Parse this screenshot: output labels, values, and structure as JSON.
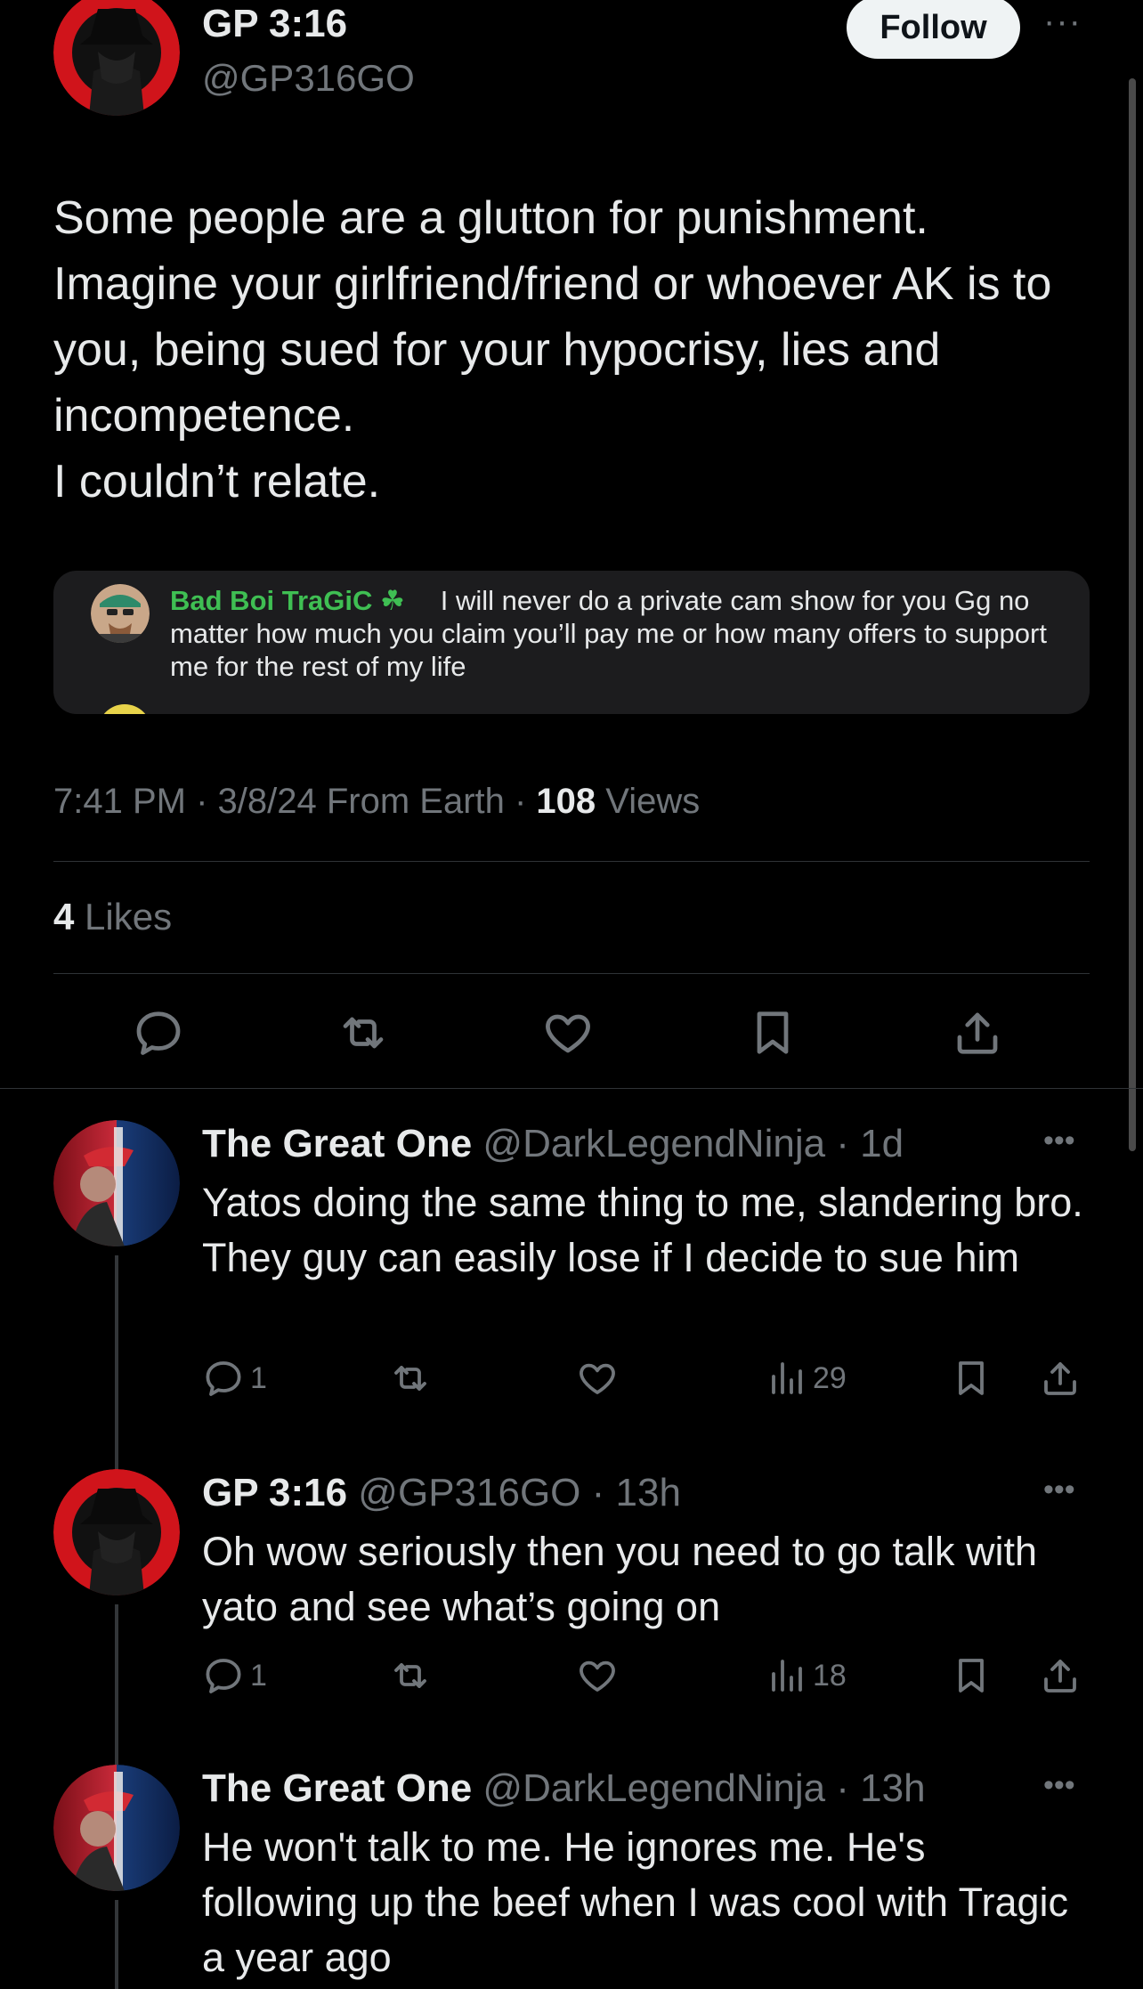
{
  "main_tweet": {
    "name": "GP 3:16",
    "handle": "@GP316GO",
    "follow_label": "Follow",
    "more_label": "···",
    "text": "Some people are a glutton for punishment.\nImagine your girlfriend/friend or whoever AK is to you, being sued for your hypocrisy, lies and incompetence.\nI couldn’t relate.",
    "quote": {
      "name": "Bad Boi TraGiC ☘",
      "text": "I will never do a private cam show for you Gg no matter how much you claim you’ll pay me or how many offers to support me for the rest of my life"
    },
    "time": "7:41 PM · 3/8/24 From Earth · ",
    "views_count": "108",
    "views_label": " Views",
    "likes_count": "4",
    "likes_label": " Likes"
  },
  "replies": [
    {
      "name": "The Great One",
      "handle": " @DarkLegendNinja · 1d",
      "text": "Yatos doing the same thing to me, slandering bro. They guy can easily lose if I decide to sue him",
      "reply_count": "1",
      "views": "29"
    },
    {
      "name": "GP 3:16",
      "handle": " @GP316GO · 13h",
      "text": "Oh wow seriously then you need to go talk with yato and see what’s going on",
      "reply_count": "1",
      "views": "18"
    },
    {
      "name": "The Great One",
      "handle": " @DarkLegendNinja · 13h",
      "text": "He won't talk to me. He ignores me. He's following up the beef when I was cool with Tragic a year ago"
    }
  ],
  "colors": {
    "background": "#000000",
    "text": "#e7e9ea",
    "muted": "#71767b",
    "quote_name": "#3fbf53",
    "avatar_red": "#d0141b"
  }
}
